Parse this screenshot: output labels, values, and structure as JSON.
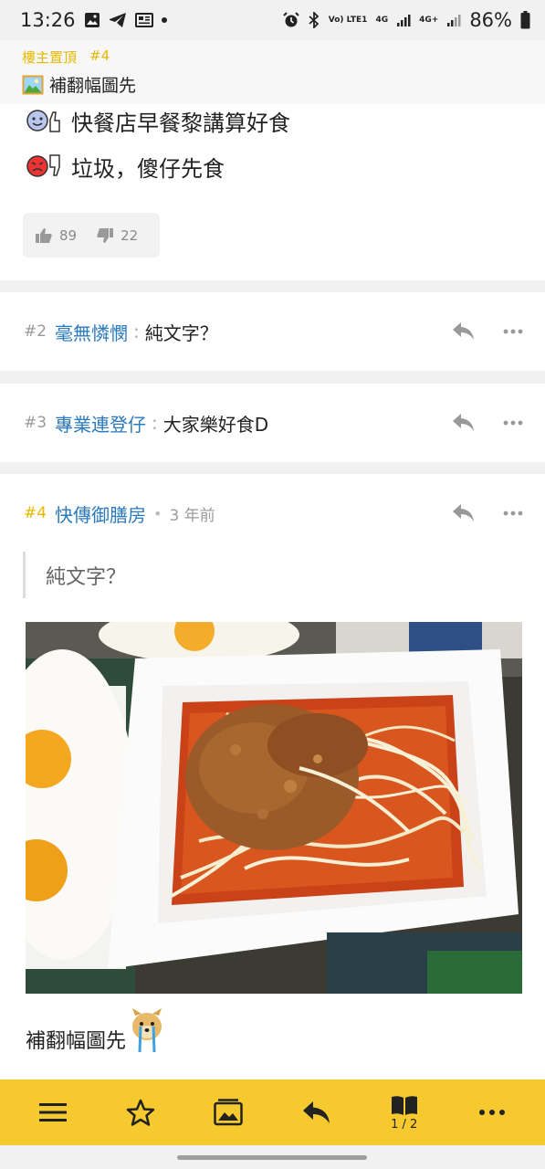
{
  "status_bar": {
    "time": "13:26",
    "net_volte": "Vo) LTE1",
    "net_4g": "4G",
    "net_4g_plus": "4G+",
    "battery": "86%"
  },
  "thread": {
    "op_label": "樓主置頂",
    "op_floor": "#4",
    "title": "補翻幅圖先"
  },
  "post1": {
    "line1": "快餐店早餐黎講算好食",
    "line2": "垃圾，傻仔先食",
    "likes": "89",
    "dislikes": "22"
  },
  "replies": [
    {
      "floor": "#2",
      "user": "毫無憐憫",
      "colon": ":",
      "text": "純文字？"
    },
    {
      "floor": "#3",
      "user": "專業連登仔",
      "colon": ":",
      "text": "大家樂好食D"
    }
  ],
  "post4": {
    "floor": "#4",
    "user": "快傳御膳房",
    "sep": "•",
    "time_ago": "3 年前",
    "quote": "純文字？",
    "text": "補翻幅圖先"
  },
  "bottom_bar": {
    "page_indicator": "1 / 2"
  },
  "icons": {
    "menu": "hamburger-icon",
    "favorite": "star-icon",
    "gallery": "gallery-icon",
    "reply": "reply-icon",
    "pages": "book-icon",
    "more": "more-icon"
  },
  "colors": {
    "accent_yellow": "#f6c92e",
    "username_blue": "#2b7abf",
    "op_floor_yellow": "#e6b800"
  }
}
